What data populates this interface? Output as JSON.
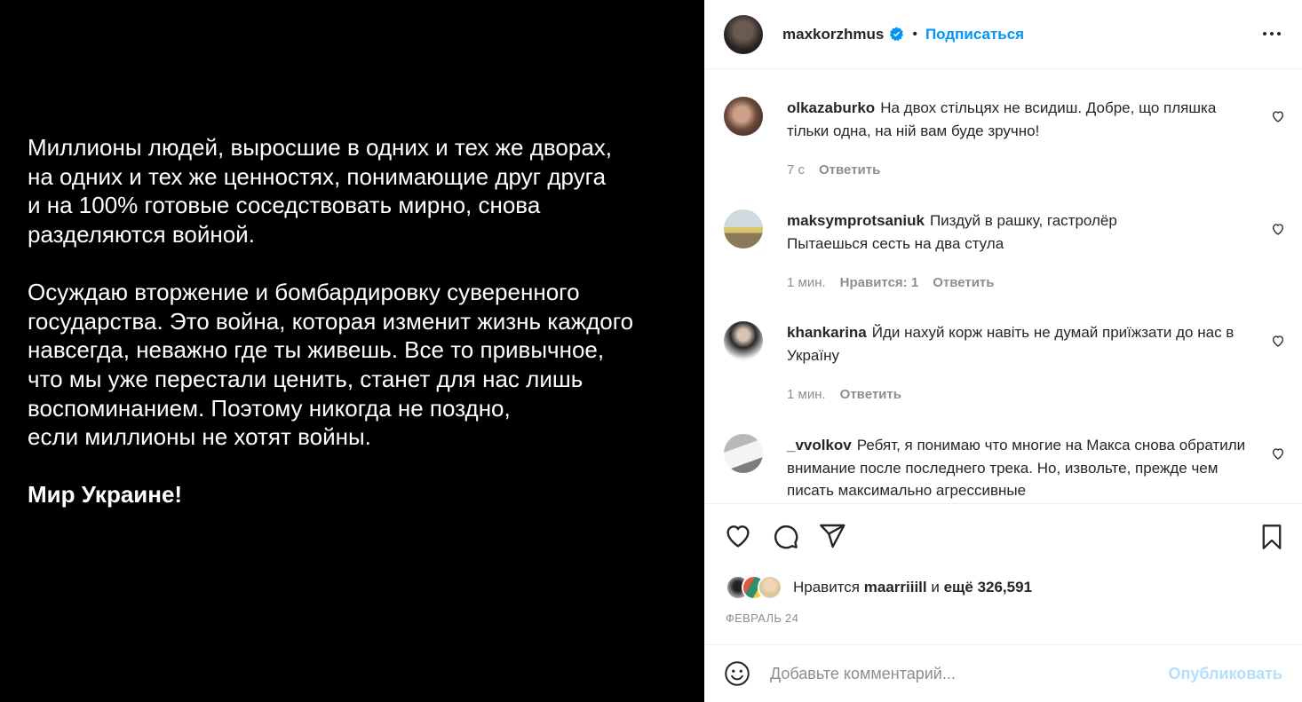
{
  "post": {
    "paragraphs": [
      "Миллионы людей, выросшие в одних и тех же дворах,\nна одних и тех же ценностях, понимающие друг друга\nи на 100% готовые соседствовать мирно, снова\nразделяются войной.",
      "Осуждаю вторжение и бомбардировку суверенного\nгосударства. Это война, которая изменит жизнь каждого\nнавсегда, неважно где ты живешь. Все то привычное,\nчто мы уже перестали ценить, станет для нас лишь\nвоспоминанием. Поэтому никогда не поздно,\nесли миллионы не хотят войны.",
      "Мир Украине!"
    ]
  },
  "header": {
    "username": "maxkorzhmus",
    "dot": "•",
    "follow_label": "Подписаться"
  },
  "comments": [
    {
      "username": "olkazaburko",
      "text": "На двох стільцях не всидиш. Добре, що пляшка тільки одна, на ній вам буде зручно!",
      "time": "7 с",
      "likes": "",
      "reply_label": "Ответить"
    },
    {
      "username": "maksymprotsaniuk",
      "text": "Пиздуй в рашку, гастролёр\nПытаешься сесть на два стула",
      "time": "1 мин.",
      "likes": "Нравится: 1",
      "reply_label": "Ответить"
    },
    {
      "username": "khankarina",
      "text": "Йди нахуй корж навіть не думай приїжзати до нас в Україну",
      "time": "1 мин.",
      "likes": "",
      "reply_label": "Ответить"
    },
    {
      "username": "_vvolkov",
      "text": "Ребят, я понимаю что многие на Макса снова обратили внимание после последнего трека. Но, извольте, прежде чем писать максимально агрессивные",
      "time": "",
      "likes": "",
      "reply_label": ""
    }
  ],
  "likes": {
    "prefix": "Нравится",
    "user": "maarriiill",
    "conj": "и",
    "more": "ещё 326,591"
  },
  "date": "ФЕВРАЛЬ 24",
  "add_comment": {
    "placeholder": "Добавьте комментарий...",
    "publish_label": "Опубликовать"
  },
  "colors": {
    "accent": "#0095f6",
    "publish_disabled": "#b2dffc",
    "muted": "#8e8e8e"
  }
}
